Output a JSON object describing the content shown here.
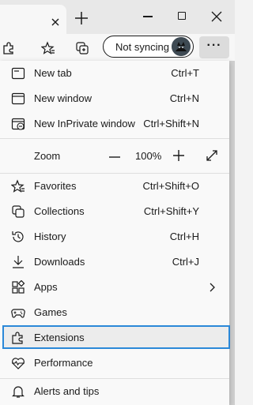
{
  "toolbar": {
    "sync_label": "Not syncing"
  },
  "menu": {
    "items": [
      {
        "label": "New tab",
        "shortcut": "Ctrl+T",
        "icon": "new-tab-icon"
      },
      {
        "label": "New window",
        "shortcut": "Ctrl+N",
        "icon": "new-window-icon"
      },
      {
        "label": "New InPrivate window",
        "shortcut": "Ctrl+Shift+N",
        "icon": "inprivate-icon"
      },
      {
        "label": "Favorites",
        "shortcut": "Ctrl+Shift+O",
        "icon": "favorites-icon"
      },
      {
        "label": "Collections",
        "shortcut": "Ctrl+Shift+Y",
        "icon": "collections-icon"
      },
      {
        "label": "History",
        "shortcut": "Ctrl+H",
        "icon": "history-icon"
      },
      {
        "label": "Downloads",
        "shortcut": "Ctrl+J",
        "icon": "downloads-icon"
      },
      {
        "label": "Apps",
        "shortcut": "",
        "icon": "apps-icon"
      },
      {
        "label": "Games",
        "shortcut": "",
        "icon": "games-icon"
      },
      {
        "label": "Extensions",
        "shortcut": "",
        "icon": "extensions-icon"
      },
      {
        "label": "Performance",
        "shortcut": "",
        "icon": "performance-icon"
      },
      {
        "label": "Alerts and tips",
        "shortcut": "",
        "icon": "bell-icon"
      }
    ],
    "zoom": {
      "label": "Zoom",
      "value": "100%"
    },
    "selected_item": "Extensions",
    "highlight_color": "#2b88d8"
  }
}
